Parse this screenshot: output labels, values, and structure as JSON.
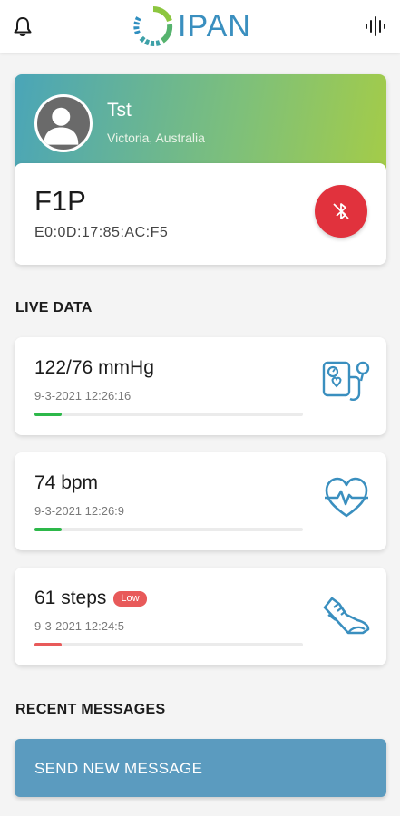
{
  "header": {
    "app_name": "IPAN",
    "left_icon": "bell-icon",
    "right_icon": "audio-wave-icon",
    "brand_color": "#3a8fbf"
  },
  "profile": {
    "name": "Tst",
    "location": "Victoria, Australia",
    "avatar_icon": "person-avatar-icon"
  },
  "device": {
    "name": "F1P",
    "mac": "E0:0D:17:85:AC:F5",
    "bluetooth_icon": "bluetooth-disabled-icon",
    "bluetooth_button_color": "#e1323d"
  },
  "live_data": {
    "title": "LIVE DATA",
    "items": [
      {
        "value": "122/76 mmHg",
        "timestamp": "9-3-2021 12:26:16",
        "progress": 0.1,
        "bar_color": "#2db84a",
        "icon": "blood-pressure-monitor-icon"
      },
      {
        "value": "74 bpm",
        "timestamp": "9-3-2021 12:26:9",
        "progress": 0.1,
        "bar_color": "#2db84a",
        "icon": "heart-rate-icon"
      },
      {
        "value": "61 steps",
        "badge": "Low",
        "timestamp": "9-3-2021 12:24:5",
        "progress": 0.1,
        "bar_color": "#e85a5a",
        "icon": "running-shoe-icon"
      }
    ]
  },
  "recent_messages": {
    "title": "RECENT MESSAGES",
    "send_button_label": "SEND NEW MESSAGE"
  }
}
